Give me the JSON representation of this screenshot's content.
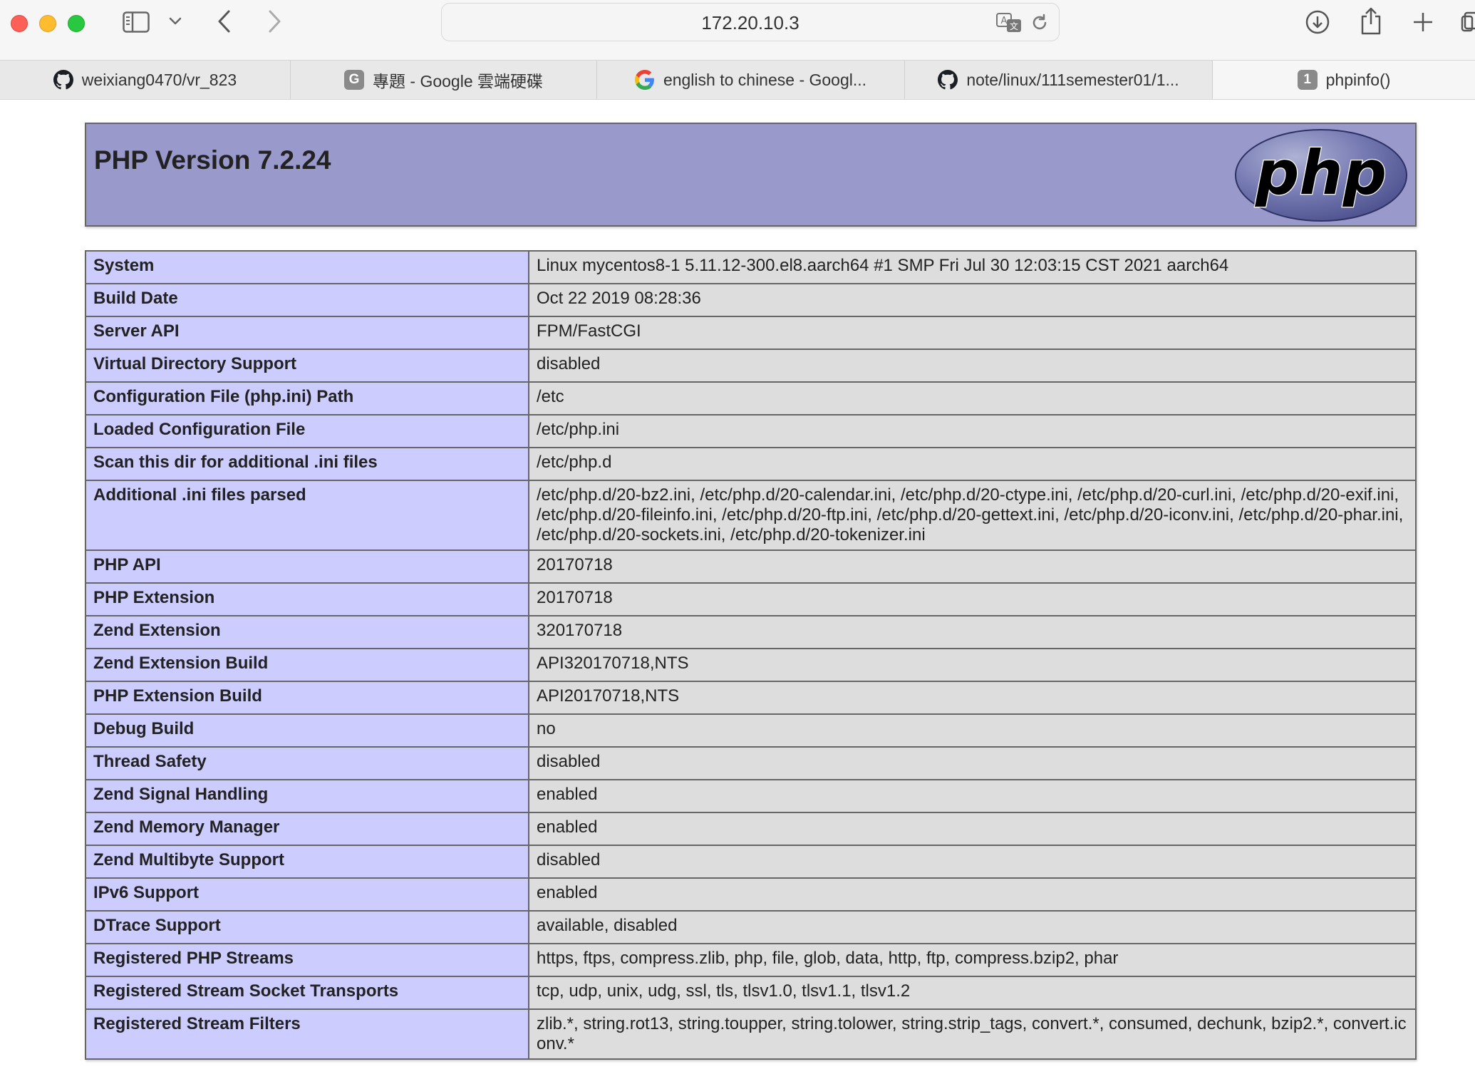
{
  "browser": {
    "url": "172.20.10.3",
    "tabs": [
      {
        "label": "weixiang0470/vr_823",
        "icon": "github-icon"
      },
      {
        "label": "專題 - Google 雲端硬碟",
        "icon": "g-badge-icon",
        "badge": "G"
      },
      {
        "label": "english to chinese - Googl...",
        "icon": "google-icon"
      },
      {
        "label": "note/linux/111semester01/1...",
        "icon": "github-icon"
      },
      {
        "label": "phpinfo()",
        "icon": "number-badge-icon",
        "badge": "1"
      }
    ]
  },
  "phpinfo": {
    "title": "PHP Version 7.2.24",
    "logo_text": "php",
    "rows": [
      {
        "key": "System",
        "value": "Linux mycentos8-1 5.11.12-300.el8.aarch64 #1 SMP Fri Jul 30 12:03:15 CST 2021 aarch64"
      },
      {
        "key": "Build Date",
        "value": "Oct 22 2019 08:28:36"
      },
      {
        "key": "Server API",
        "value": "FPM/FastCGI"
      },
      {
        "key": "Virtual Directory Support",
        "value": "disabled"
      },
      {
        "key": "Configuration File (php.ini) Path",
        "value": "/etc"
      },
      {
        "key": "Loaded Configuration File",
        "value": "/etc/php.ini"
      },
      {
        "key": "Scan this dir for additional .ini files",
        "value": "/etc/php.d"
      },
      {
        "key": "Additional .ini files parsed",
        "value": "/etc/php.d/20-bz2.ini, /etc/php.d/20-calendar.ini, /etc/php.d/20-ctype.ini, /etc/php.d/20-curl.ini, /etc/php.d/20-exif.ini, /etc/php.d/20-fileinfo.ini, /etc/php.d/20-ftp.ini, /etc/php.d/20-gettext.ini, /etc/php.d/20-iconv.ini, /etc/php.d/20-phar.ini, /etc/php.d/20-sockets.ini, /etc/php.d/20-tokenizer.ini"
      },
      {
        "key": "PHP API",
        "value": "20170718"
      },
      {
        "key": "PHP Extension",
        "value": "20170718"
      },
      {
        "key": "Zend Extension",
        "value": "320170718"
      },
      {
        "key": "Zend Extension Build",
        "value": "API320170718,NTS"
      },
      {
        "key": "PHP Extension Build",
        "value": "API20170718,NTS"
      },
      {
        "key": "Debug Build",
        "value": "no"
      },
      {
        "key": "Thread Safety",
        "value": "disabled"
      },
      {
        "key": "Zend Signal Handling",
        "value": "enabled"
      },
      {
        "key": "Zend Memory Manager",
        "value": "enabled"
      },
      {
        "key": "Zend Multibyte Support",
        "value": "disabled"
      },
      {
        "key": "IPv6 Support",
        "value": "enabled"
      },
      {
        "key": "DTrace Support",
        "value": "available, disabled"
      },
      {
        "key": "Registered PHP Streams",
        "value": "https, ftps, compress.zlib, php, file, glob, data, http, ftp, compress.bzip2, phar"
      },
      {
        "key": "Registered Stream Socket Transports",
        "value": "tcp, udp, unix, udg, ssl, tls, tlsv1.0, tlsv1.1, tlsv1.2"
      },
      {
        "key": "Registered Stream Filters",
        "value": "zlib.*, string.rot13, string.toupper, string.tolower, string.strip_tags, convert.*, consumed, dechunk, bzip2.*, convert.iconv.*"
      }
    ]
  },
  "colors": {
    "header_bg": "#9999cc",
    "key_cell_bg": "#ccccff",
    "value_cell_bg": "#dddddd",
    "table_border": "#666666"
  }
}
